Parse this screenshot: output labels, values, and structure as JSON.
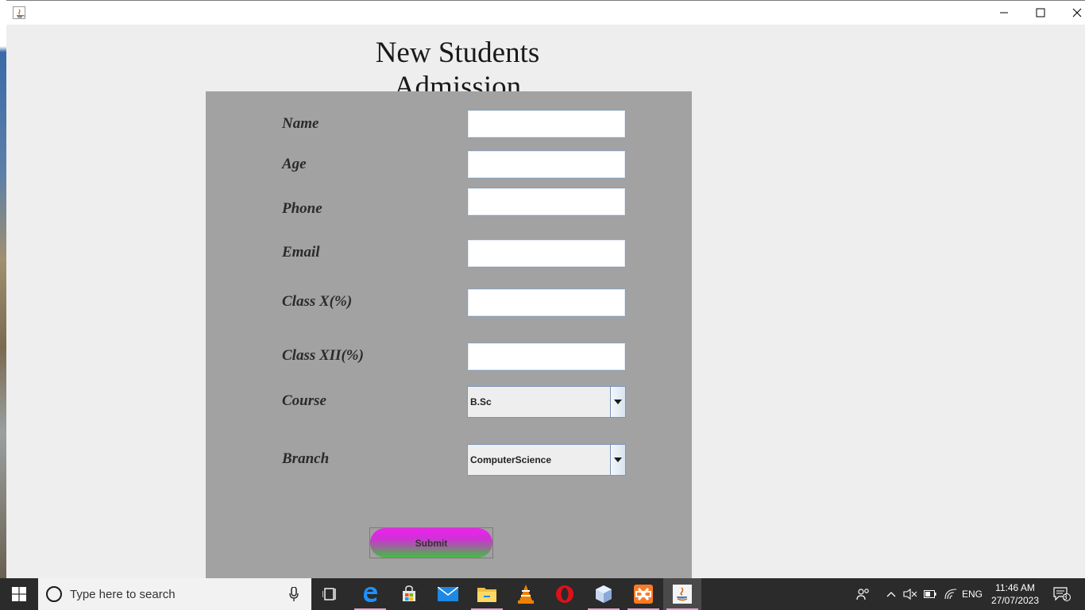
{
  "window": {
    "title": ""
  },
  "form": {
    "title": "New Students Admission",
    "fields": [
      {
        "label": "Name",
        "value": ""
      },
      {
        "label": "Age",
        "value": ""
      },
      {
        "label": "Phone",
        "value": ""
      },
      {
        "label": "Email",
        "value": ""
      },
      {
        "label": "Class X(%)",
        "value": ""
      },
      {
        "label": "Class XII(%)",
        "value": ""
      }
    ],
    "course": {
      "label": "Course",
      "selected": "B.Sc"
    },
    "branch": {
      "label": "Branch",
      "selected": "ComputerScience"
    },
    "submit_label": "Submit"
  },
  "taskbar": {
    "search_placeholder": "Type here to search",
    "language": "ENG",
    "time": "11:46 AM",
    "date": "27/07/2023",
    "notification_count": "3"
  }
}
